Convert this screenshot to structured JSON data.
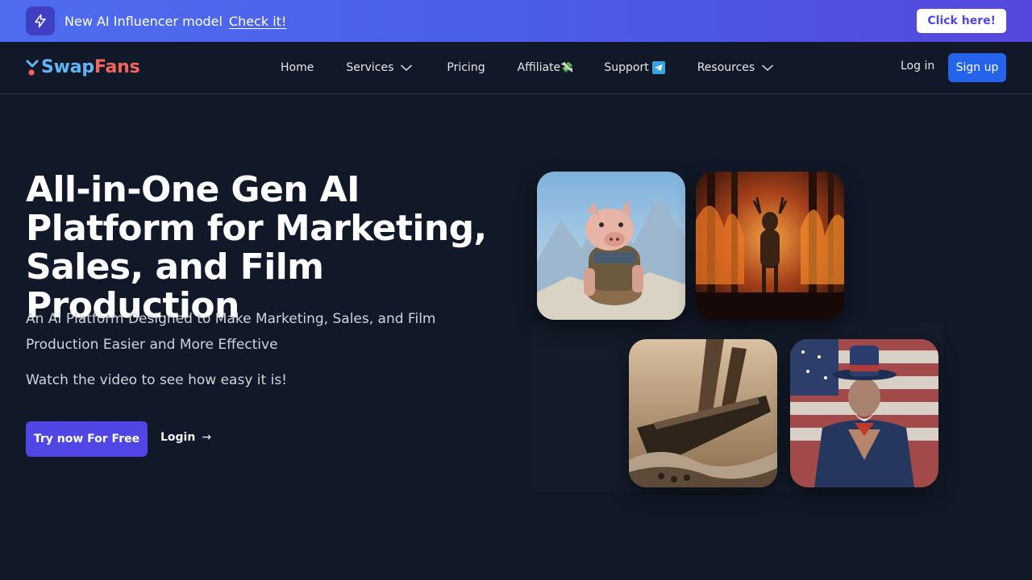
{
  "banner": {
    "icon": "lightning-bolt-icon",
    "text": "New AI Influencer model",
    "link": "Check it!",
    "button": "Click here!"
  },
  "nav": {
    "logo_swap": "Swap",
    "logo_fans": "Fans",
    "items": [
      {
        "label": "Home"
      },
      {
        "label": "Services",
        "dropdown": true
      },
      {
        "label": "Pricing"
      },
      {
        "label": "Affiliate",
        "emoji": "💸"
      },
      {
        "label": "Support",
        "icon": "telegram-icon"
      },
      {
        "label": "Resources",
        "dropdown": true
      }
    ],
    "login": "Log in",
    "signup": "Sign up"
  },
  "hero": {
    "title": "All-in-One Gen AI Platform for Marketing, Sales, and Film Production",
    "subtitle": "An AI Platform Designed to Make Marketing, Sales, and Film Production Easier and More Effective",
    "watch": "Watch the video to see how easy it is!",
    "cta": "Try now For Free",
    "login": "Login",
    "login_arrow": "→"
  },
  "gallery": [
    {
      "subject": "warrior-pig"
    },
    {
      "subject": "deer-in-fire"
    },
    {
      "subject": "sinking-ship"
    },
    {
      "subject": "uncle-sam"
    }
  ],
  "colors": {
    "background": "#111827",
    "banner_start": "#4f6cf0",
    "banner_end": "#5548dc",
    "primary": "#4f46e5",
    "signup": "#2563eb",
    "logo_swap": "#5fb8f5",
    "logo_fans": "#f2665c"
  }
}
